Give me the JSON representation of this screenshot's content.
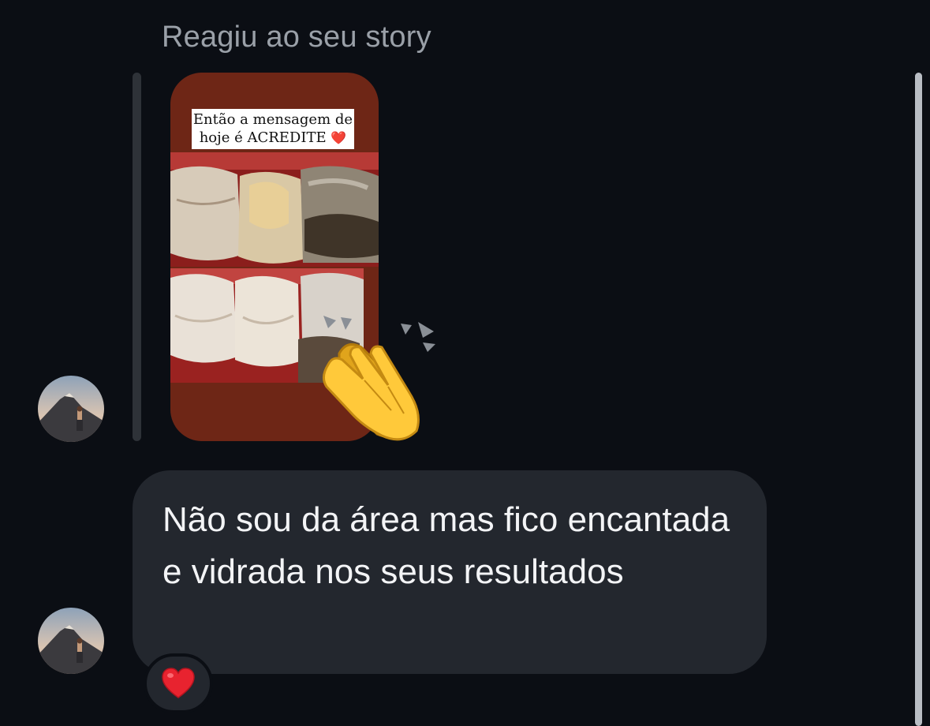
{
  "thread": {
    "story_reply_caption": "Reagiu ao seu story",
    "story": {
      "text_line_1": "Então a mensagem de",
      "text_line_2": "hoje é ACREDITE",
      "text_emoji": "❤️",
      "background_color": "#6e2616",
      "image_description_icon": "teeth-before-after"
    },
    "reaction_on_story": {
      "icon": "clapping-hands-icon"
    },
    "message": {
      "text": "Não sou da área mas fico encantada e vidrada nos seus resultados",
      "reaction": {
        "icon": "red-heart-icon"
      }
    },
    "sender_avatar": {
      "icon": "profile-avatar"
    }
  },
  "colors": {
    "background": "#0b0e14",
    "bubble": "#23272e",
    "caption_text": "#9aa0a8",
    "message_text": "#f3f4f6",
    "reply_bar": "#2e3238",
    "scrollbar": "#b9bdc4"
  }
}
